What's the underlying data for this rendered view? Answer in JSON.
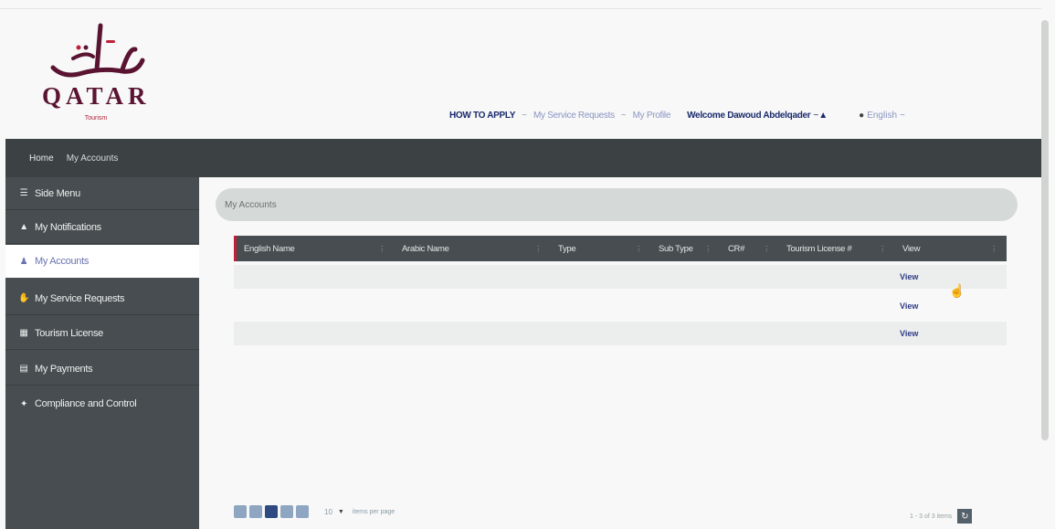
{
  "logo": {
    "latin": "QATAR",
    "subtitle": "Tourism"
  },
  "topnav": {
    "how_to_apply": "HOW TO APPLY",
    "service_requests": "My Service Requests",
    "profile": "My Profile",
    "welcome": "Welcome Dawoud Abdelqader",
    "language": "English"
  },
  "breadcrumb": {
    "home": "Home",
    "current": "My Accounts"
  },
  "sidebar": {
    "items": [
      {
        "label": "Side Menu",
        "icon": "hamburger-icon"
      },
      {
        "label": "My Notifications",
        "icon": "bell-icon"
      },
      {
        "label": "My Accounts",
        "icon": "users-icon",
        "active": true
      },
      {
        "label": "My Service Requests",
        "icon": "handshake-icon"
      },
      {
        "label": "Tourism License",
        "icon": "license-card-icon"
      },
      {
        "label": "My Payments",
        "icon": "payment-card-icon"
      },
      {
        "label": "Compliance and Control",
        "icon": "gavel-icon"
      }
    ]
  },
  "panel": {
    "title": "My Accounts"
  },
  "table": {
    "columns": [
      "English Name",
      "Arabic Name",
      "Type",
      "Sub Type",
      "CR#",
      "Tourism License #",
      "View"
    ],
    "rows": [
      {
        "english": "",
        "arabic": "",
        "type": "",
        "subtype": "",
        "cr": "",
        "license": "",
        "view": "View"
      },
      {
        "english": "",
        "arabic": "",
        "type": "",
        "subtype": "",
        "cr": "",
        "license": "",
        "view": "View"
      },
      {
        "english": "",
        "arabic": "",
        "type": "",
        "subtype": "",
        "cr": "",
        "license": "",
        "view": "View"
      }
    ]
  },
  "pagination": {
    "page_size": "10",
    "page_size_label": "items per page",
    "count": "1 - 3 of 3 items"
  },
  "colors": {
    "sidebar_bg": "#474d50",
    "breadcrumb_bg": "#3c4244",
    "accent_red": "#c0203a",
    "link_blue": "#2f3a86"
  }
}
